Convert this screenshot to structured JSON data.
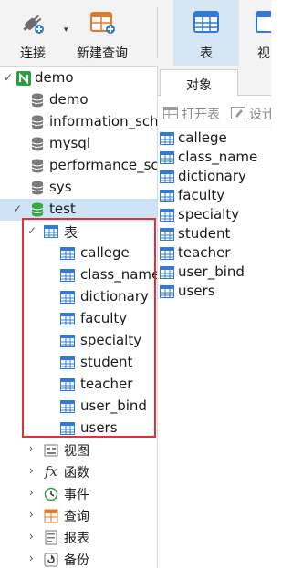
{
  "toolbar": {
    "connect_label": "连接",
    "new_query_label": "新建查询",
    "table_label": "表",
    "view_label": "视"
  },
  "tree": {
    "root": "demo",
    "databases": [
      "demo",
      "information_sch",
      "mysql",
      "performance_sc",
      "sys"
    ],
    "selected_db": "test",
    "tables_folder": "表",
    "tables": [
      "callege",
      "class_name",
      "dictionary",
      "faculty",
      "specialty",
      "student",
      "teacher",
      "user_bind",
      "users"
    ],
    "other_folders": [
      "视图",
      "函数",
      "事件",
      "查询",
      "报表",
      "备份"
    ]
  },
  "right_panel": {
    "tab_label": "对象",
    "open_table_label": "打开表",
    "design_label": "设计",
    "tables": [
      "callege",
      "class_name",
      "dictionary",
      "faculty",
      "specialty",
      "student",
      "teacher",
      "user_bind",
      "users"
    ]
  },
  "colors": {
    "selection": "#cfe3f7",
    "highlight_border": "#e0313a",
    "accent_blue": "#2f7bd6",
    "db_green": "#3aa843"
  }
}
